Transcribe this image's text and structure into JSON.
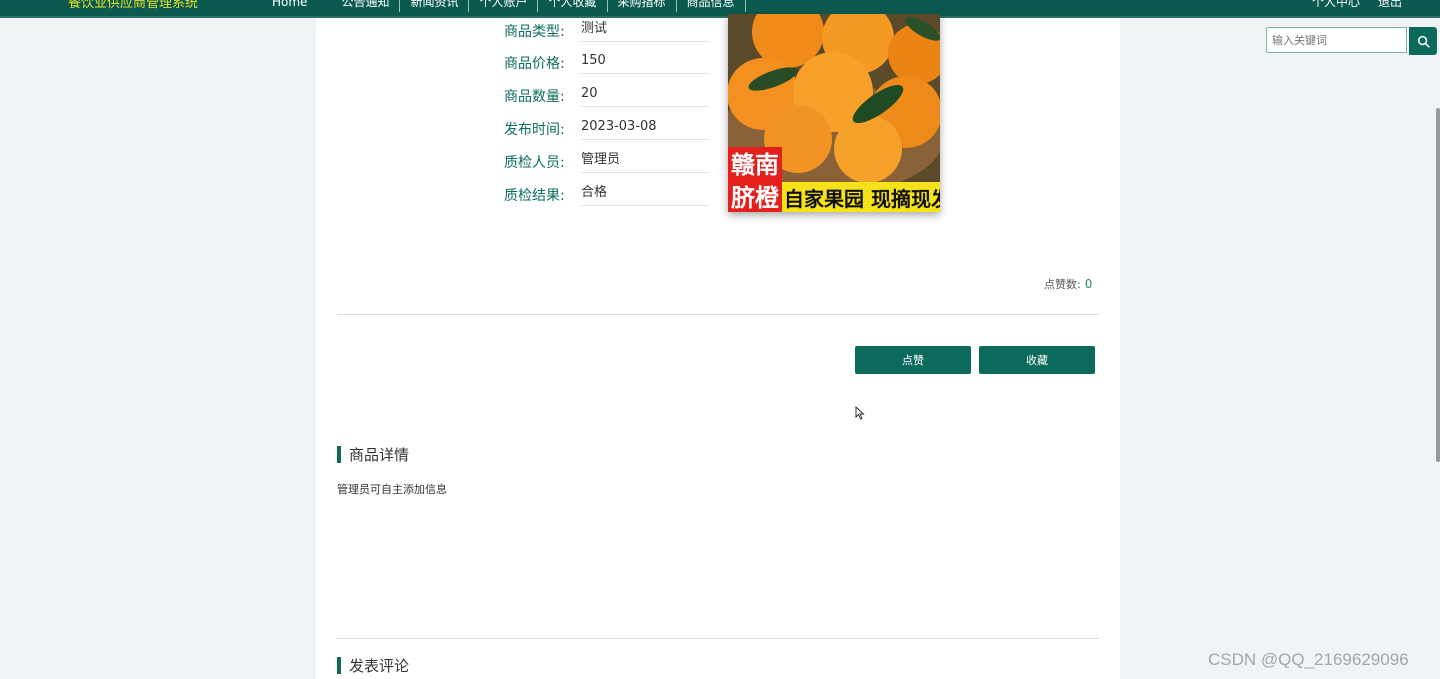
{
  "header": {
    "brand": "餐饮业供应商管理系统",
    "nav_items": [
      "Home",
      "公告通知",
      "新闻资讯",
      "个人账户",
      "个人收藏",
      "采购指标",
      "商品信息"
    ],
    "right_items": [
      "个人中心",
      "退出"
    ]
  },
  "search": {
    "placeholder": "输入关键词",
    "icon": "search-icon"
  },
  "product_fields": [
    {
      "label": "商品类型:",
      "value": "测试"
    },
    {
      "label": "商品价格:",
      "value": "150"
    },
    {
      "label": "商品数量:",
      "value": "20"
    },
    {
      "label": "发布时间:",
      "value": "2023-03-08"
    },
    {
      "label": "质检人员:",
      "value": "管理员"
    },
    {
      "label": "质检结果:",
      "value": "合格"
    }
  ],
  "product_image": {
    "caption_red": [
      "赣南",
      "脐橙"
    ],
    "caption_yellow": "自家果园 现摘现发"
  },
  "likes": {
    "label": "点赞数:",
    "count": "0"
  },
  "actions": {
    "like_label": "点赞",
    "favorite_label": "收藏"
  },
  "detail_section": {
    "title": "商品详情",
    "text": "管理员可自主添加信息"
  },
  "comment_section": {
    "title": "发表评论"
  },
  "watermark": "CSDN @QQ_2169629096",
  "colors": {
    "accent": "#0b6a5c",
    "brand_text": "#e6e02a",
    "page_bg": "#f1f4f7"
  }
}
